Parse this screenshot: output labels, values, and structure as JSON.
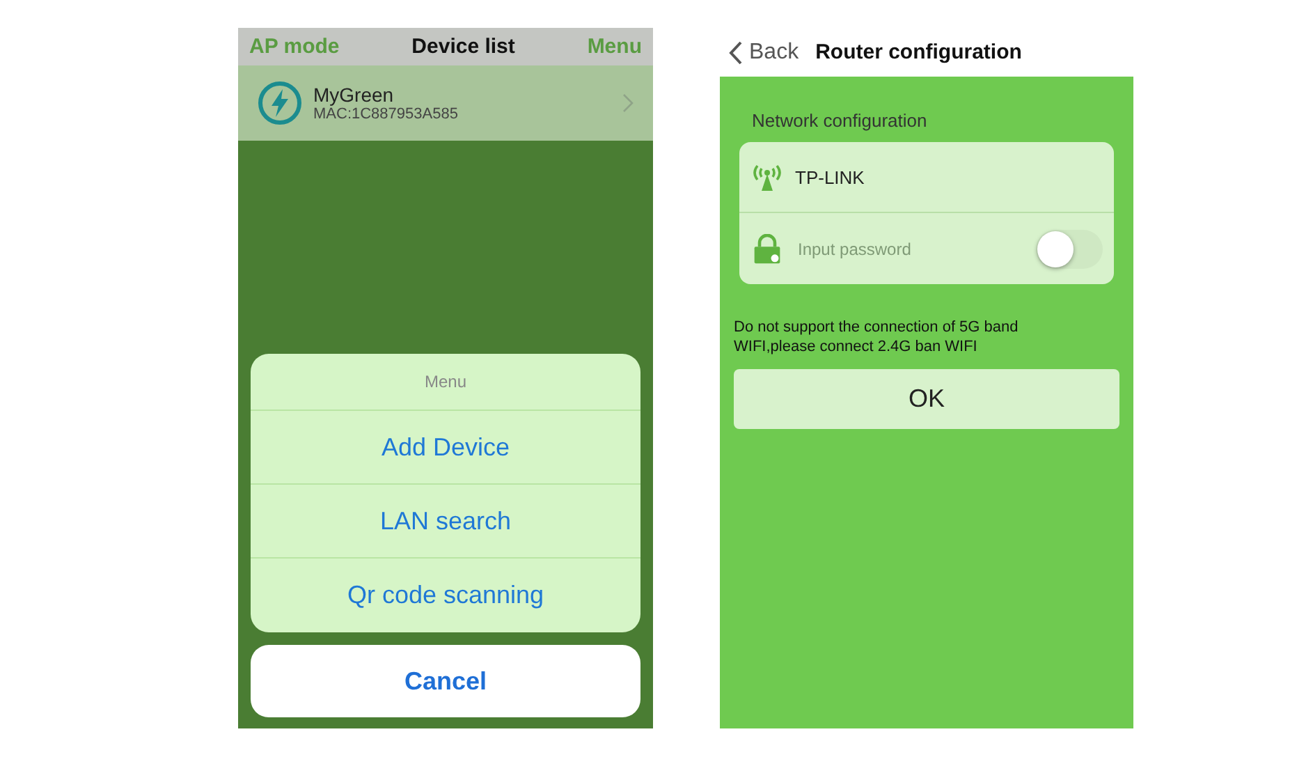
{
  "left_screen": {
    "nav": {
      "left": "AP mode",
      "title": "Device list",
      "right": "Menu"
    },
    "devices": [
      {
        "name": "MyGreen",
        "mac": "MAC:1C887953A585"
      }
    ],
    "action_sheet": {
      "title": "Menu",
      "items": [
        "Add Device",
        "LAN search",
        "Qr code scanning"
      ],
      "cancel": "Cancel"
    }
  },
  "right_screen": {
    "nav": {
      "back": "Back",
      "title": "Router configuration"
    },
    "section_title": "Network configuration",
    "network": {
      "ssid": "TP-LINK",
      "password": {
        "placeholder": "Input password"
      },
      "switch": {
        "on": false
      }
    },
    "note": "Do not support the connection of 5G band WIFI,please connect 2.4G ban WIFI",
    "ok": "OK"
  }
}
